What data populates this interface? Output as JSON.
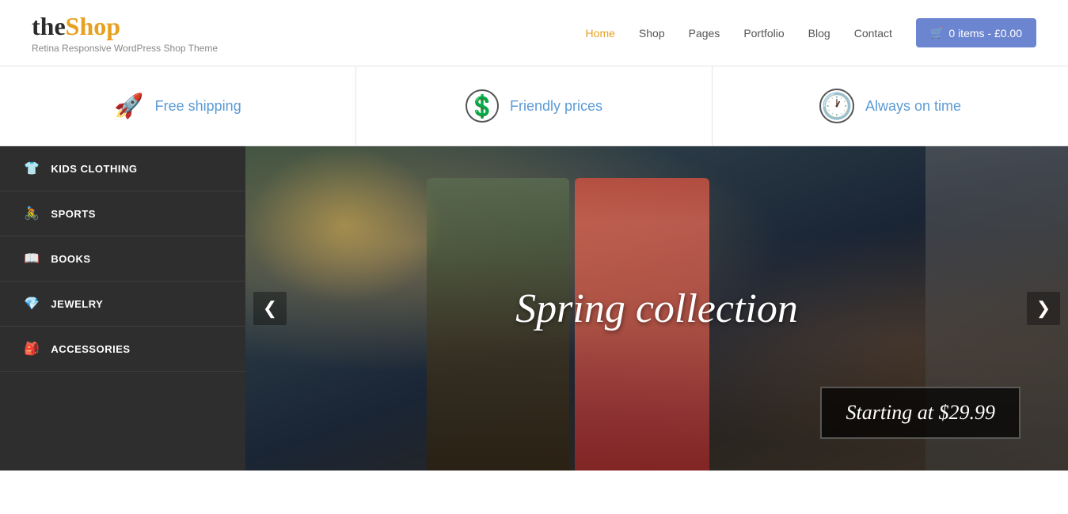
{
  "header": {
    "logo_text_the": "the",
    "logo_text_shop": "Shop",
    "logo_subtitle": "Retina Responsive WordPress Shop Theme",
    "nav": [
      {
        "label": "Home",
        "active": true
      },
      {
        "label": "Shop",
        "active": false
      },
      {
        "label": "Pages",
        "active": false
      },
      {
        "label": "Portfolio",
        "active": false
      },
      {
        "label": "Blog",
        "active": false
      },
      {
        "label": "Contact",
        "active": false
      }
    ],
    "cart_label": "0 items - £0.00"
  },
  "features": [
    {
      "icon": "🚀",
      "label": "Free shipping"
    },
    {
      "icon": "💰",
      "label": "Friendly prices"
    },
    {
      "icon": "🕐",
      "label": "Always on time"
    }
  ],
  "sidebar": {
    "items": [
      {
        "label": "Kids Clothing",
        "icon": "👕"
      },
      {
        "label": "Sports",
        "icon": "🚴"
      },
      {
        "label": "Books",
        "icon": "📖"
      },
      {
        "label": "Jewelry",
        "icon": "💎"
      },
      {
        "label": "Accessories",
        "icon": "👜"
      }
    ]
  },
  "slider": {
    "title": "Spring collection",
    "price_label": "Starting at $29.99",
    "arrow_left": "❮",
    "arrow_right": "❯"
  },
  "colors": {
    "accent_blue": "#5b9bd5",
    "cart_btn": "#6c85d0",
    "sidebar_bg": "#2e2e2e",
    "nav_active": "#e8a020"
  }
}
